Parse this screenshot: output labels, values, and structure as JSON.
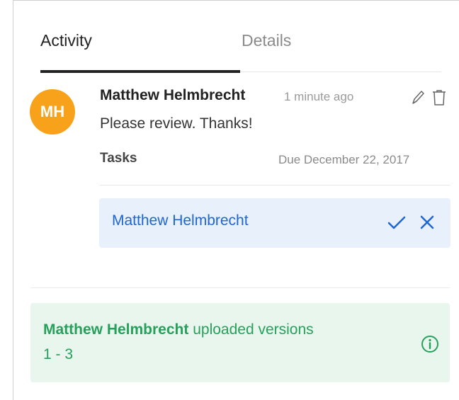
{
  "tabs": [
    {
      "label": "Activity",
      "active": true
    },
    {
      "label": "Details",
      "active": false
    }
  ],
  "comment": {
    "avatar_initials": "MH",
    "avatar_color": "#f7a21a",
    "author": "Matthew Helmbrecht",
    "timestamp": "1 minute ago",
    "message": "Please review. Thanks!",
    "edit_icon": "pencil-icon",
    "delete_icon": "trash-icon"
  },
  "tasks": {
    "label": "Tasks",
    "due": "Due December 22, 2017",
    "assignees": [
      {
        "name": "Matthew Helmbrecht",
        "approve_icon": "checkmark-icon",
        "reject_icon": "close-icon"
      }
    ]
  },
  "version_event": {
    "actor": "Matthew Helmbrecht",
    "action": "uploaded versions",
    "range": "1 - 3",
    "icon": "info-icon",
    "color": "#27a05c"
  },
  "colors": {
    "task_bg": "#e7f0fb",
    "task_text": "#1f66d1",
    "version_bg": "#e8f6ee"
  }
}
